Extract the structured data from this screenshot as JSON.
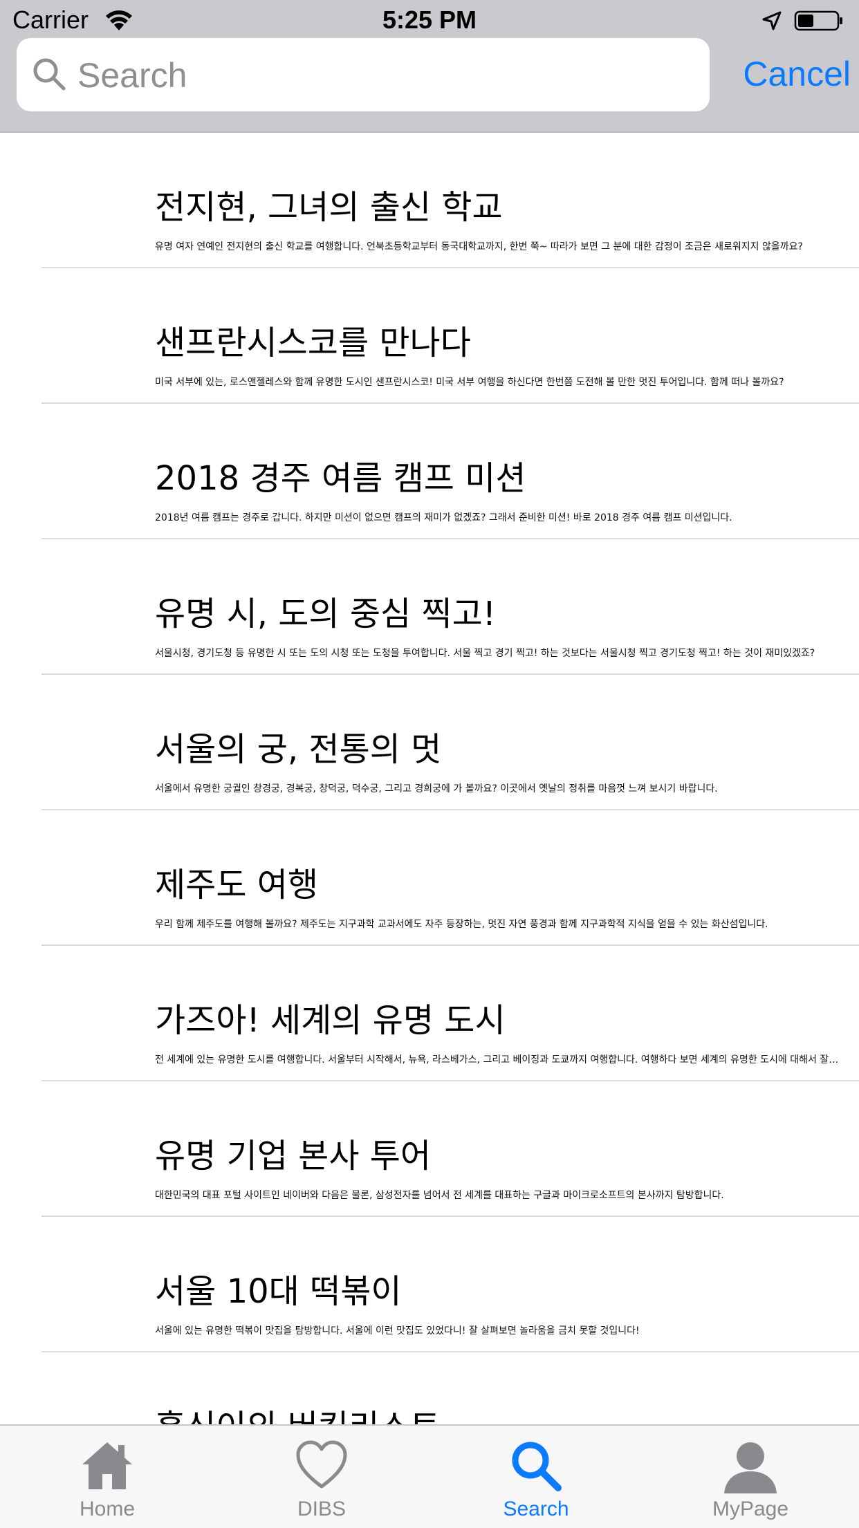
{
  "status_bar": {
    "carrier": "Carrier",
    "time": "5:25 PM"
  },
  "search": {
    "placeholder": "Search",
    "value": "",
    "cancel_label": "Cancel"
  },
  "colors": {
    "accent": "#0a7aff",
    "header_bg": "#c9c9ce",
    "inactive_tab": "#8a8a8e"
  },
  "results": [
    {
      "title": "전지현, 그녀의 출신 학교",
      "desc": "유명 여자 연예인 전지현의 출신 학교를 여행합니다. 언북초등학교부터 동국대학교까지, 한번 쭉~ 따라가 보면 그 분에 대한 감정이 조금은 새로워지지 않을까요?"
    },
    {
      "title": "샌프란시스코를 만나다",
      "desc": "미국 서부에 있는, 로스앤젤레스와 함께 유명한 도시인 샌프란시스코! 미국 서부 여행을 하신다면 한번쯤 도전해 볼 만한 멋진 투어입니다. 함께 떠나 볼까요?"
    },
    {
      "title": "2018 경주 여름 캠프 미션",
      "desc": "2018년 여름 캠프는 경주로 갑니다. 하지만 미션이 없으면 캠프의 재미가 없겠죠? 그래서 준비한 미션! 바로 2018 경주 여름 캠프 미션입니다."
    },
    {
      "title": "유명 시, 도의 중심 찍고!",
      "desc": "서울시청, 경기도청 등 유명한 시 또는 도의 시청 또는 도청을 투여합니다. 서울 찍고 경기 찍고! 하는 것보다는 서울시청 찍고 경기도청 찍고! 하는 것이 재미있겠죠?"
    },
    {
      "title": "서울의 궁, 전통의 멋",
      "desc": "서울에서 유명한 궁궐인 창경궁, 경복궁, 창덕궁, 덕수궁, 그리고 경희궁에 가 볼까요? 이곳에서 옛날의 정취를 마음껏 느껴 보시기 바랍니다."
    },
    {
      "title": "제주도 여행",
      "desc": "우리 함께 제주도를 여행해 볼까요? 제주도는 지구과학 교과서에도 자주 등장하는, 멋진 자연 풍경과 함께 지구과학적 지식을 얻을 수 있는 화산섬입니다."
    },
    {
      "title": "가즈아! 세계의 유명 도시",
      "desc": "전 세계에 있는 유명한 도시를 여행합니다. 서울부터 시작해서, 뉴욕, 라스베가스, 그리고 베이징과 도쿄까지 여행합니다. 여행하다 보면 세계의 유명한 도시에 대해서 잘 알…"
    },
    {
      "title": "유명 기업 본사 투어",
      "desc": "대한민국의 대표 포털 사이트인 네이버와 다음은 물론, 삼성전자를 넘어서 전 세계를 대표하는 구글과 마이크로소프트의 본사까지 탐방합니다."
    },
    {
      "title": "서울 10대 떡볶이",
      "desc": "서울에 있는 유명한 떡볶이 맛집을 탐방합니다. 서울에 이런 맛집도 있었다니! 잘 살펴보면 놀라움을 금치 못할 것입니다!"
    },
    {
      "title": "홍신이의 버킷리스트",
      "desc": ""
    }
  ],
  "tabs": [
    {
      "label": "Home",
      "icon": "home-icon"
    },
    {
      "label": "DIBS",
      "icon": "heart-icon"
    },
    {
      "label": "Search",
      "icon": "search-icon"
    },
    {
      "label": "MyPage",
      "icon": "person-icon"
    }
  ]
}
